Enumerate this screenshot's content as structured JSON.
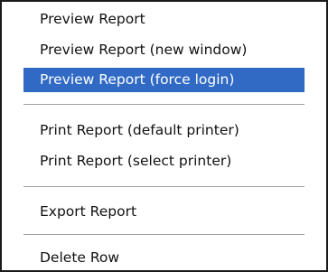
{
  "menu": {
    "items": [
      {
        "label": "Preview Report"
      },
      {
        "label": "Preview Report (new window)"
      },
      {
        "label": "Preview Report (force login)",
        "selected": true
      },
      {
        "label": "Print Report (default printer)"
      },
      {
        "label": "Print Report (select printer)"
      },
      {
        "label": "Export Report"
      },
      {
        "label": "Delete Row"
      }
    ]
  },
  "colors": {
    "selection_background": "#316ac5",
    "selection_text": "#ffffff",
    "text": "#111111",
    "border": "#1a1a1a",
    "separator": "#a0a0a0"
  }
}
